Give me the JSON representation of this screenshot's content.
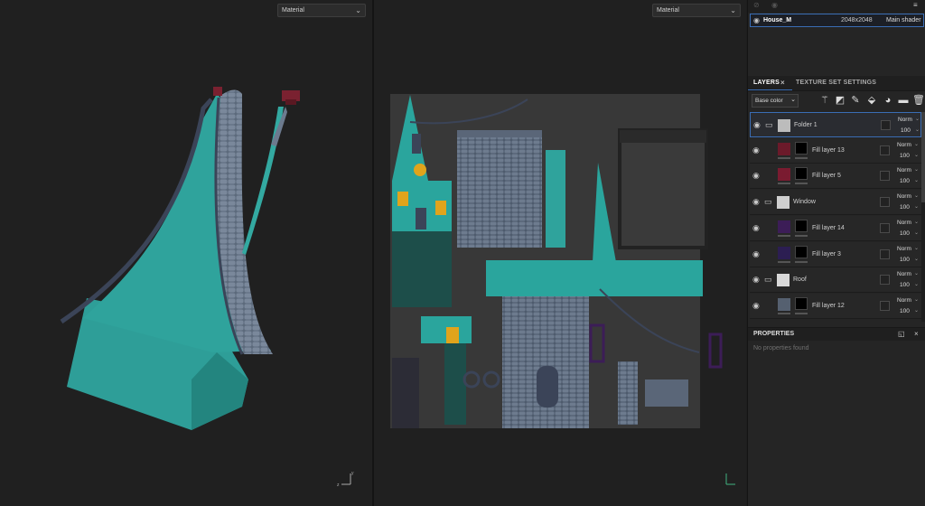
{
  "viewport3d": {
    "material_label": "Material",
    "axis": {
      "x": "x",
      "y": "y",
      "z": "z"
    }
  },
  "viewport2d": {
    "material_label": "Material"
  },
  "texture_set": {
    "name": "House_M",
    "resolution": "2048x2048",
    "shader": "Main shader"
  },
  "tabs": {
    "layers": "LAYERS",
    "texture_set_settings": "TEXTURE SET SETTINGS"
  },
  "toolbar": {
    "channel": "Base color"
  },
  "layers": [
    {
      "name": "Folder 1",
      "blend": "Norm",
      "opacity": "100",
      "kind": "folder",
      "thumb_color": "#bcbcbc",
      "mask_color": "",
      "selected": true
    },
    {
      "name": "Fill layer 13",
      "blend": "Norm",
      "opacity": "100",
      "kind": "fill",
      "thumb_color": "#6b1a2a",
      "mask_color": "#000000",
      "selected": false
    },
    {
      "name": "Fill layer 5",
      "blend": "Norm",
      "opacity": "100",
      "kind": "fill",
      "thumb_color": "#7a1b30",
      "mask_color": "#000000",
      "selected": false
    },
    {
      "name": "Window",
      "blend": "Norm",
      "opacity": "100",
      "kind": "folder",
      "thumb_color": "#cfcfcf",
      "mask_color": "",
      "selected": false
    },
    {
      "name": "Fill layer 14",
      "blend": "Norm",
      "opacity": "100",
      "kind": "fill",
      "thumb_color": "#3c1d57",
      "mask_color": "#000000",
      "selected": false
    },
    {
      "name": "Fill layer 3",
      "blend": "Norm",
      "opacity": "100",
      "kind": "fill",
      "thumb_color": "#2c1e52",
      "mask_color": "#000000",
      "selected": false
    },
    {
      "name": "Roof",
      "blend": "Norm",
      "opacity": "100",
      "kind": "folder",
      "thumb_color": "#d8d8d8",
      "mask_color": "",
      "selected": false
    },
    {
      "name": "Fill layer 12",
      "blend": "Norm",
      "opacity": "100",
      "kind": "fill",
      "thumb_color": "#556070",
      "mask_color": "#000000",
      "selected": false
    }
  ],
  "properties": {
    "title": "PROPERTIES",
    "empty_text": "No properties found"
  },
  "colors": {
    "accent": "#3a6db5",
    "teal": "#2f9c94",
    "shingle": "#6a7789",
    "window": "#e0a41c"
  }
}
